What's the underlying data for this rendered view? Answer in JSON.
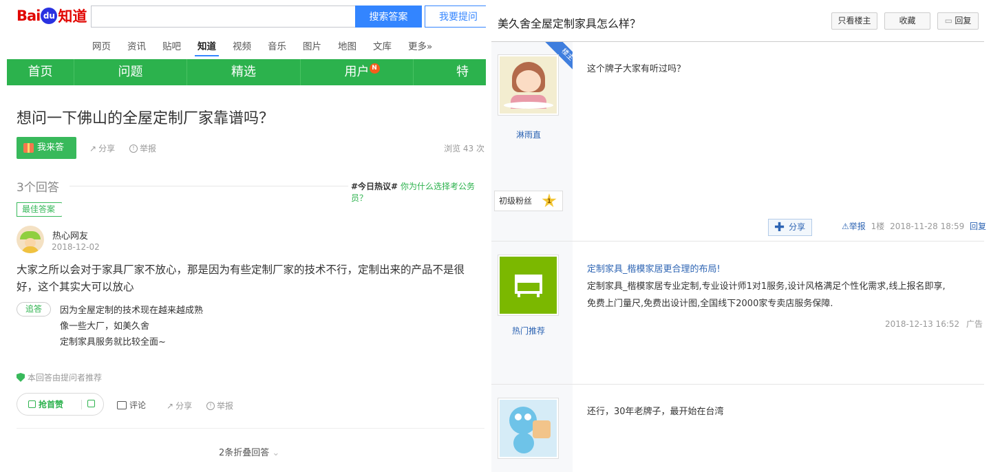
{
  "left": {
    "logo": {
      "part1": "Bai",
      "paw": "du",
      "part2": "知道"
    },
    "search": {
      "button": "搜索答案",
      "ask": "我要提问",
      "placeholder": ""
    },
    "topnav": [
      "网页",
      "资讯",
      "贴吧",
      "知道",
      "视频",
      "音乐",
      "图片",
      "地图",
      "文库",
      "更多»"
    ],
    "topnav_active": "知道",
    "greennav": [
      "首页",
      "问题",
      "精选",
      "用户",
      "特"
    ],
    "greennav_badge": "N",
    "question": {
      "title": "想问一下佛山的全屋定制厂家靠谱吗？",
      "answer_button": "我来答",
      "share": "分享",
      "report": "举报",
      "views": "浏览 43 次"
    },
    "answers_header": {
      "count": "3个回答",
      "hot_prefix": "#今日热议#",
      "hot_link": "你为什么选择考公务员？"
    },
    "best_answer": {
      "badge": "最佳答案",
      "username": "热心网友",
      "date": "2018-12-02",
      "text": "大家之所以会对于家具厂家不放心，那是因为有些定制厂家的技术不行，定制出来的产品不是很好，这个其实大可以放心",
      "followup_tag": "追答",
      "followup_lines": [
        "因为全屋定制的技术现在越来越成熟",
        "像一些大厂，如美久舍",
        "定制家具服务就比较全面~"
      ],
      "recommended_note": "本回答由提问者推荐",
      "vote_up": "抢首赞",
      "comment": "评论",
      "share": "分享",
      "report": "举报"
    },
    "folded": "2条折叠回答"
  },
  "right": {
    "title": "美久舍全屋定制家具怎么样？",
    "buttons": {
      "only_op": "只看楼主",
      "favorite": "收藏",
      "reply": "回复"
    },
    "post1": {
      "corner_tag": "楼主",
      "username": "淋雨直",
      "fan_level": "初级粉丝",
      "fan_level_num": "1",
      "content": "这个牌子大家有听过吗？",
      "share": "分享",
      "report": "举报",
      "floor": "1楼",
      "datetime": "2018-11-28 18:59",
      "reply": "回复"
    },
    "post2": {
      "username": "热门推荐",
      "ad_title": "定制家具_楷模家居更合理的布局!",
      "ad_text_line1": "定制家具_楷模家居专业定制,专业设计师1对1服务,设计风格满足个性化需求,线上报名即享,",
      "ad_text_line2": "免费上门量尺,免费出设计图,全国线下2000家专卖店服务保障.",
      "datetime": "2018-12-13 16:52",
      "ad_label": "广告"
    },
    "post3": {
      "content": "还行，30年老牌子，最开始在台湾"
    }
  },
  "colors": {
    "baidu_blue": "#3385ff",
    "zhidao_green": "#2cb24d",
    "link_blue": "#2d64b3"
  }
}
